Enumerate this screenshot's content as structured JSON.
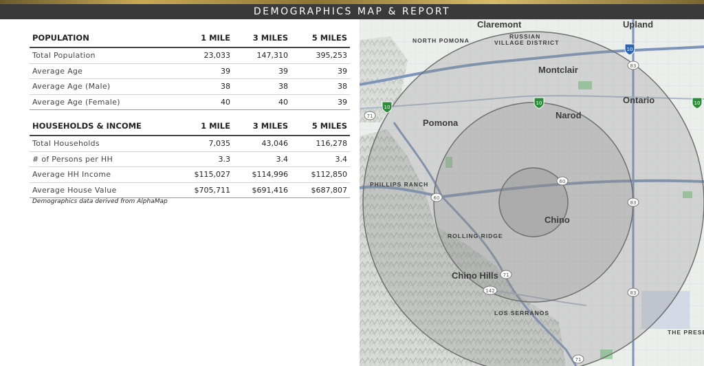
{
  "header": {
    "title": "DEMOGRAPHICS MAP & REPORT"
  },
  "population": {
    "header": [
      "POPULATION",
      "1 MILE",
      "3 MILES",
      "5 MILES"
    ],
    "rows": [
      [
        "Total Population",
        "23,033",
        "147,310",
        "395,253"
      ],
      [
        "Average Age",
        "39",
        "39",
        "39"
      ],
      [
        "Average Age (Male)",
        "38",
        "38",
        "38"
      ],
      [
        "Average Age (Female)",
        "40",
        "40",
        "39"
      ]
    ]
  },
  "households": {
    "header": [
      "HOUSEHOLDS & INCOME",
      "1 MILE",
      "3 MILES",
      "5 MILES"
    ],
    "rows": [
      [
        "Total Households",
        "7,035",
        "43,046",
        "116,278"
      ],
      [
        "# of Persons per HH",
        "3.3",
        "3.4",
        "3.4"
      ],
      [
        "Average HH Income",
        "$115,027",
        "$114,996",
        "$112,850"
      ],
      [
        "Average House Value",
        "$705,711",
        "$691,416",
        "$687,807"
      ]
    ]
  },
  "footnote": "Demographics data derived from AlphaMap",
  "map": {
    "cities": {
      "claremont": "Claremont",
      "upland": "Upland",
      "montclair": "Montclair",
      "ontario": "Ontario",
      "pomona": "Pomona",
      "narod": "Narod",
      "chino": "Chino",
      "chino_hills": "Chino Hills"
    },
    "areas": {
      "north_pomona": "NORTH POMONA",
      "russian_village_1": "RUSSIAN",
      "russian_village_2": "VILLAGE DISTRICT",
      "phillips_ranch": "PHILLIPS RANCH",
      "rolling_ridge": "ROLLING RIDGE",
      "los_serranos": "LOS SERRANOS",
      "the_preserve": "THE PRESE"
    },
    "routes": {
      "i10": "10",
      "r83": "83",
      "r71": "71",
      "r60": "60",
      "r142": "142"
    },
    "colors": {
      "radius_fill": "#8c8c8c",
      "radius_stroke": "#6e6e6e",
      "highway": "#7d95b8",
      "park": "#9ed6a4"
    }
  }
}
